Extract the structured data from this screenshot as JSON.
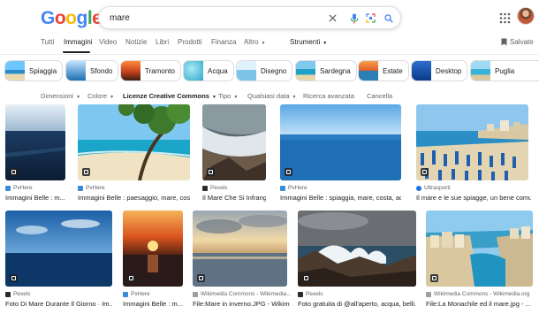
{
  "search": {
    "query": "mare"
  },
  "header": {
    "logo_letters": [
      "G",
      "o",
      "o",
      "g",
      "l",
      "e"
    ],
    "saved_label": "Salvate"
  },
  "nav": {
    "tabs": [
      "Tutti",
      "Immagini",
      "Video",
      "Notizie",
      "Libri",
      "Prodotti",
      "Finanza",
      "Altro"
    ],
    "tools": "Strumenti"
  },
  "chips": [
    "Spiaggia",
    "Sfondo",
    "Tramonto",
    "Acqua",
    "Disegno",
    "Sardegna",
    "Estate",
    "Desktop",
    "Puglia"
  ],
  "filters": [
    "Dimensioni",
    "Colore",
    "Licenze Creative Commons",
    "Tipo",
    "Qualsiasi data",
    "Ricerca avanzata",
    "Cancella"
  ],
  "results": [
    {
      "source": "PxHere",
      "caption": "Immagini Belle : m..."
    },
    {
      "source": "PxHere",
      "caption": "Immagini Belle : paesaggio, mare, cos..."
    },
    {
      "source": "Pexels",
      "caption": "Il Mare Che Si Infrang..."
    },
    {
      "source": "PxHere",
      "caption": "Immagini Belle : spiaggia, mare, costa, ac..."
    },
    {
      "source": "Ultrasporti",
      "caption": "Il mare e le sue spiagge, un bene comu..."
    },
    {
      "source": "Pexels",
      "caption": "Foto Di Mare Durante Il Giorno · Im..."
    },
    {
      "source": "PxHere",
      "caption": "Immagini Belle : m..."
    },
    {
      "source": "Wikimedia Commons - Wikimedia...",
      "caption": "File:Mare in inverno.JPG - Wikimedia..."
    },
    {
      "source": "Pexels",
      "caption": "Foto gratuita di @all'aperto, acqua, belli..."
    },
    {
      "source": "Wikimedia Commons - Wikimedia.org",
      "caption": "File:La Monachile ed il mare.jpg - ..."
    }
  ],
  "colors": {
    "accent_blue": "#1a73e8",
    "text": "#202124",
    "muted": "#5f6368"
  }
}
